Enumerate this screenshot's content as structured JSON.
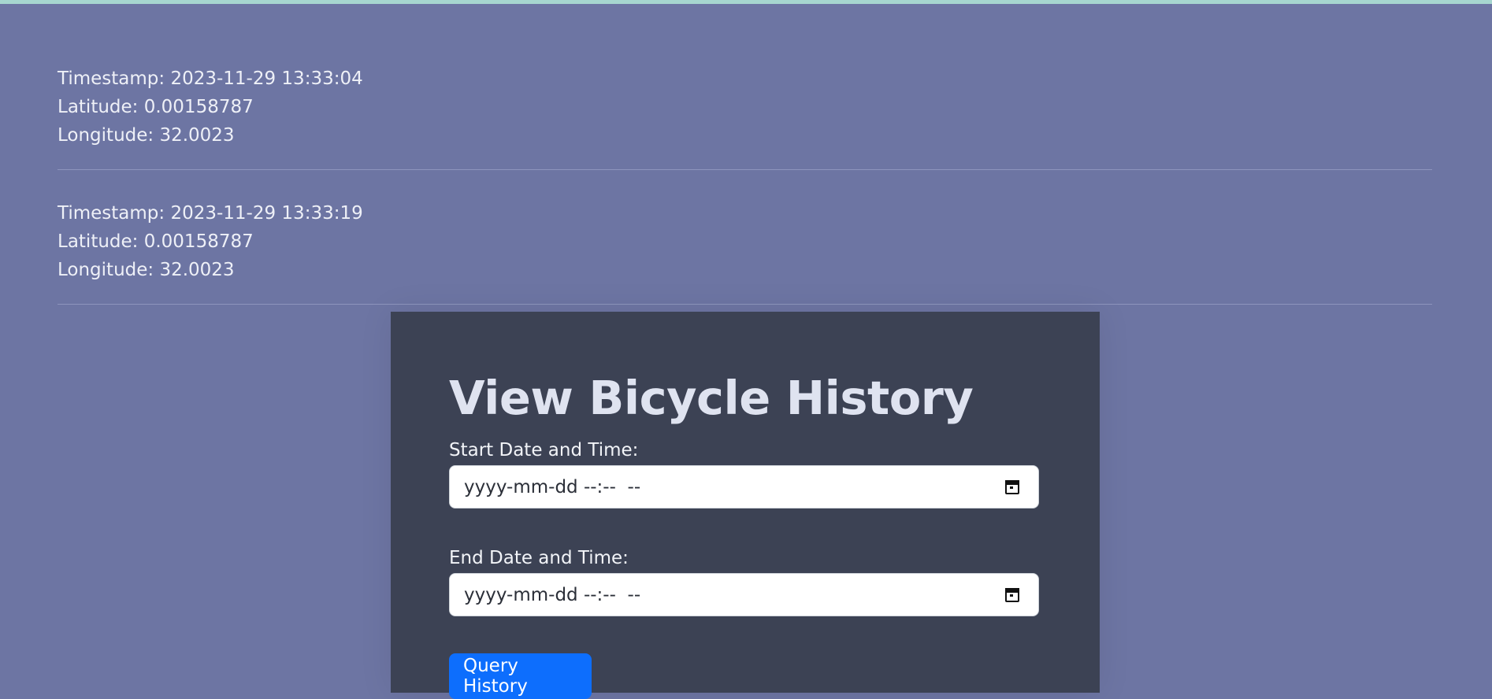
{
  "records": [
    {
      "timestamp": "Timestamp: 2023-11-29 13:33:04",
      "latitude": "Latitude: 0.00158787",
      "longitude": "Longitude: 32.0023"
    },
    {
      "timestamp": "Timestamp: 2023-11-29 13:33:19",
      "latitude": "Latitude: 0.00158787",
      "longitude": "Longitude: 32.0023"
    }
  ],
  "history_form": {
    "title": "View Bicycle History",
    "start_label": "Start Date and Time:",
    "start_placeholder": "yyyy-mm-dd --:--  --",
    "end_label": "End Date and Time:",
    "end_placeholder": "yyyy-mm-dd --:--  --",
    "submit_label": "Query History",
    "calendar_icon": "calendar-icon"
  },
  "colors": {
    "page_background": "#6d75a3",
    "card_background": "#3c4254",
    "button_primary": "#0d6efd"
  }
}
